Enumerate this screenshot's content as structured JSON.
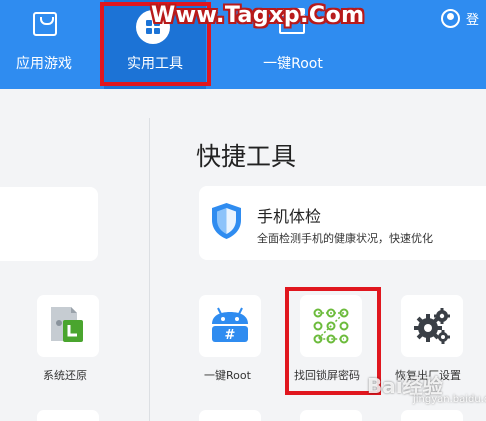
{
  "watermark": "Www.Tagxp.Com",
  "nav": {
    "tabs": [
      {
        "label": "应用游戏",
        "icon": "shopping-bag-icon",
        "active": false
      },
      {
        "label": "实用工具",
        "icon": "toolbox-icon",
        "active": true
      },
      {
        "label": "一键Root",
        "icon": "box-icon",
        "active": false
      }
    ],
    "login_label": "登"
  },
  "section": {
    "title": "快捷工具"
  },
  "checkup": {
    "title": "手机体检",
    "description": "全面检测手机的健康状况，快速优化",
    "icon": "shield-icon"
  },
  "tools": [
    {
      "label": "系统还原",
      "icon": "restore-icon"
    },
    {
      "label": "一键Root",
      "icon": "android-root-icon"
    },
    {
      "label": "找回锁屏密码",
      "icon": "pattern-lock-icon"
    },
    {
      "label": "恢复出厂设置",
      "icon": "gears-icon"
    }
  ],
  "baidu_watermark": {
    "main": "Bai经验",
    "sub": "jingyan.baidu.com"
  },
  "colors": {
    "topbar": "#2f8cf0",
    "active_tab": "#1c73d6",
    "highlight": "#e0161e",
    "pattern_green": "#6cbb3c"
  }
}
